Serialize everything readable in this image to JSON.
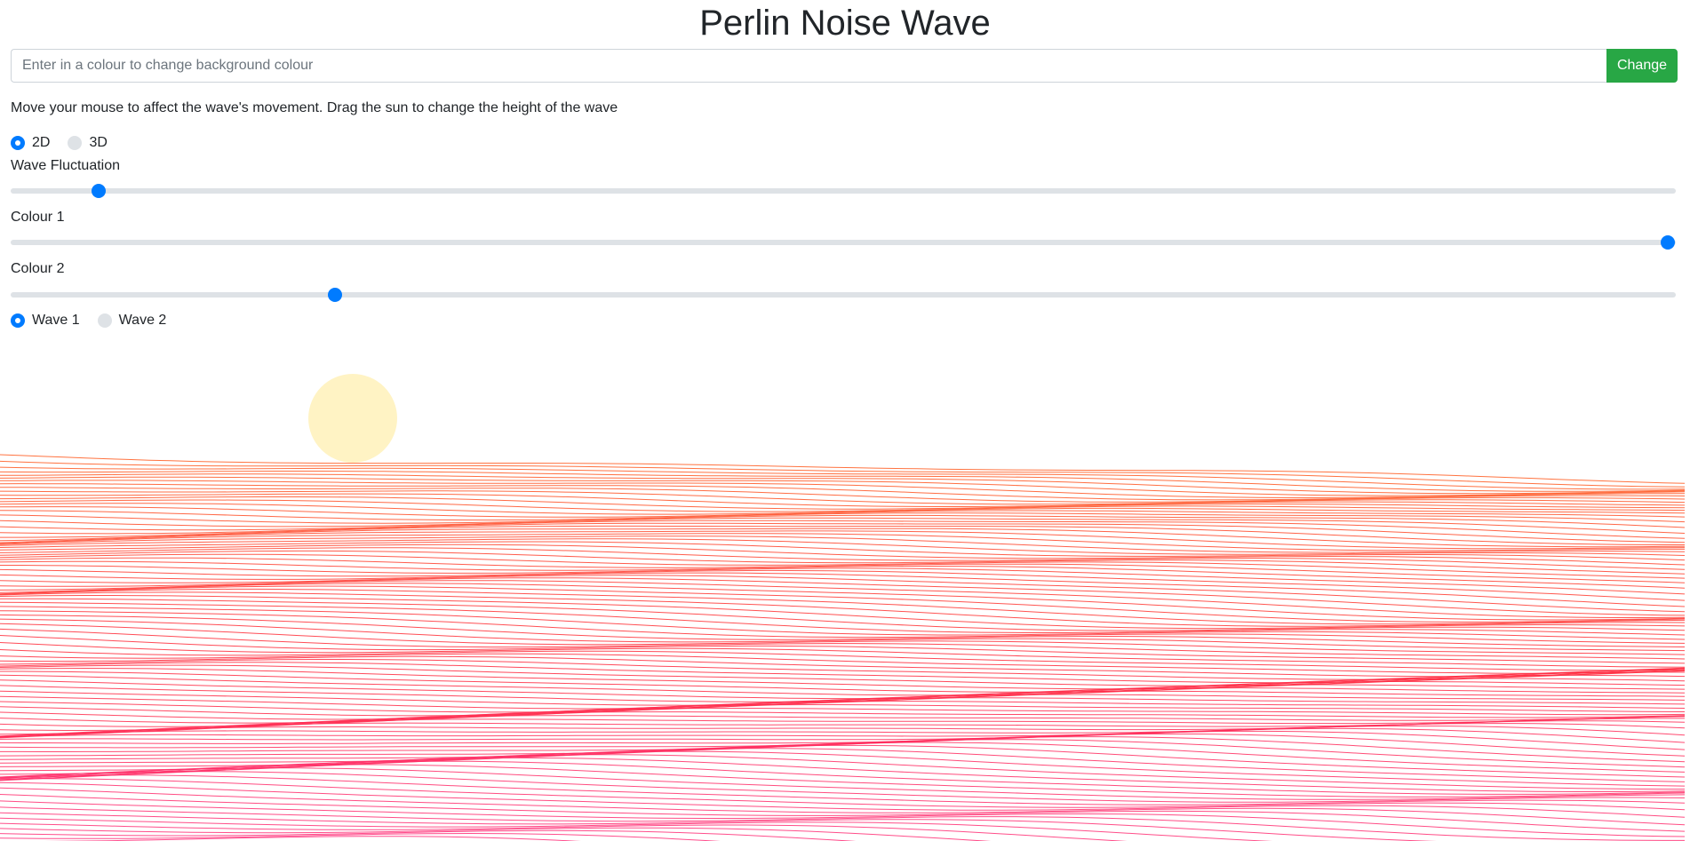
{
  "header": {
    "title": "Perlin Noise Wave"
  },
  "background_form": {
    "placeholder": "Enter in a colour to change background colour",
    "value": "",
    "button_label": "Change",
    "button_color": "#28a745"
  },
  "instructions": "Move your mouse to affect the wave's movement. Drag the sun to change the height of the wave",
  "mode": {
    "options": [
      {
        "label": "2D",
        "checked": true
      },
      {
        "label": "3D",
        "checked": false
      }
    ]
  },
  "sliders": [
    {
      "label": "Wave Fluctuation",
      "value_fraction": 0.053
    },
    {
      "label": "Colour 1",
      "value_fraction": 0.995
    },
    {
      "label": "Colour 2",
      "value_fraction": 0.195
    }
  ],
  "wave_select": {
    "options": [
      {
        "label": "Wave 1",
        "checked": true
      },
      {
        "label": "Wave 2",
        "checked": false
      }
    ]
  },
  "colors": {
    "accent": "#007bff",
    "sun": "#fff3c4",
    "wave_top": "#ff5a1f",
    "wave_mid": "#ff2a3a",
    "wave_bottom": "#ff2f7a"
  }
}
